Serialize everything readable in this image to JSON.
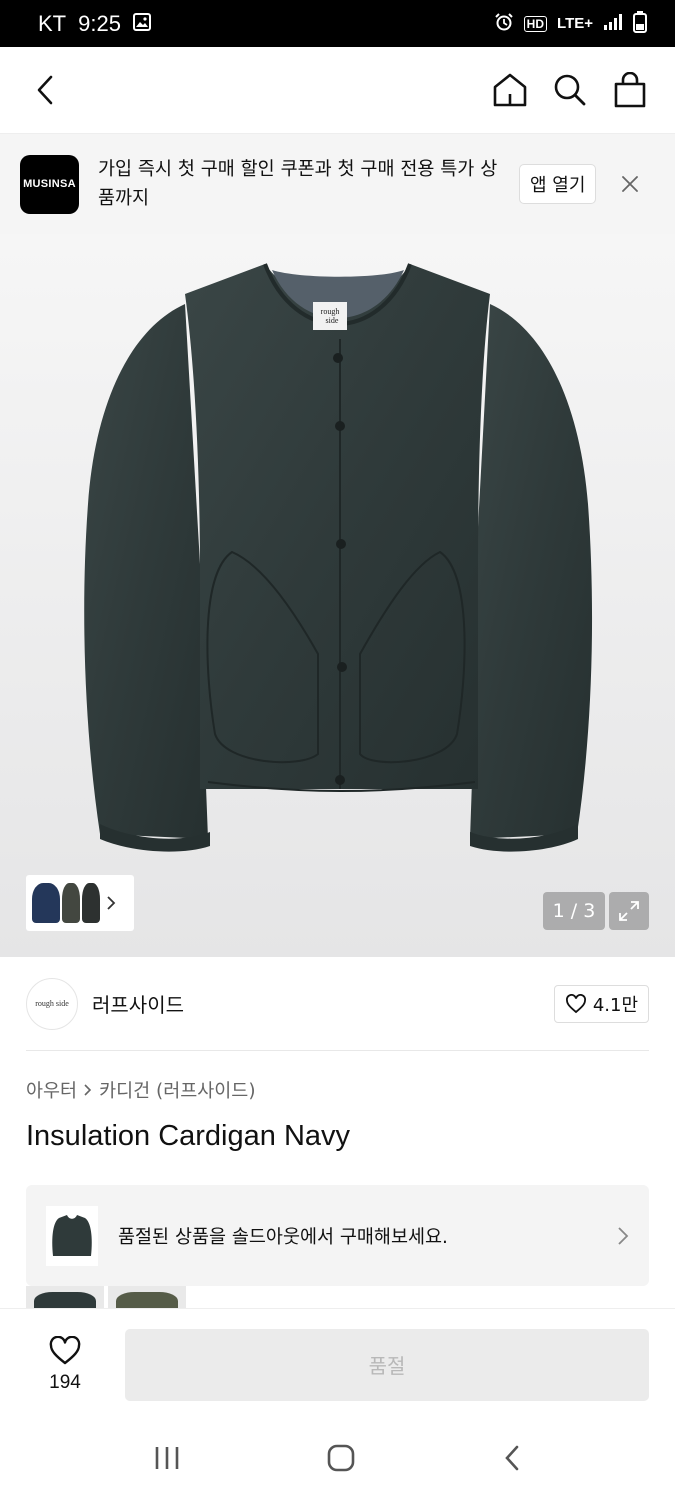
{
  "status_bar": {
    "carrier": "KT",
    "time": "9:25",
    "network": "LTE+",
    "hd": "HD"
  },
  "header": {
    "icons": [
      "back-icon",
      "home-icon",
      "search-icon",
      "cart-icon"
    ]
  },
  "app_banner": {
    "logo_text": "MUSINSA",
    "message": "가입 즉시 첫 구매 할인 쿠폰과 첫 구매 전용 특가 상품까지",
    "open_app_label": "앱 열기"
  },
  "gallery": {
    "page_counter": "1 / 3",
    "product_label_line1": "rough",
    "product_label_line2": "side",
    "thumbnail_colors": [
      "#24375a",
      "#434740",
      "#2d3130"
    ]
  },
  "brand": {
    "logo_text": "rough side",
    "name": "러프사이드",
    "likes": "4.1만"
  },
  "breadcrumb": {
    "category": "아우터",
    "subcategory": "카디건 (러프사이드)"
  },
  "product": {
    "title": "Insulation Cardigan Navy"
  },
  "soldout_card": {
    "text": "품절된 상품을 솔드아웃에서 구매해보세요."
  },
  "bottom_bar": {
    "like_count": "194",
    "buy_label": "품절"
  },
  "colors": {
    "jacket": "#2f3a3a",
    "brand_black": "#000000",
    "disabled_button": "#ebebeb"
  }
}
